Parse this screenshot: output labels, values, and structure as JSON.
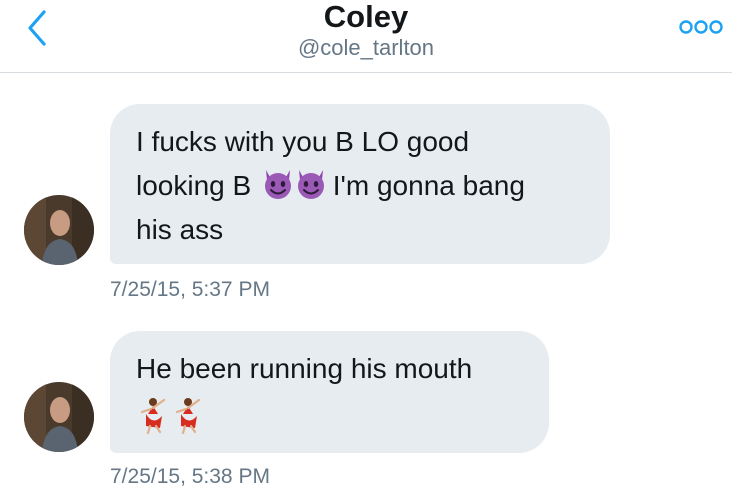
{
  "header": {
    "name": "Coley",
    "handle": "@cole_tarlton",
    "back_icon": "chevron-left-icon",
    "more_icon": "more-options-icon",
    "accent_color": "#1da1f2"
  },
  "messages": [
    {
      "text_part_1": "I fucks with you B LO good",
      "text_part_2": "looking B",
      "emoji_1": "smiling-devil-emoji",
      "text_part_3": "I'm gonna bang",
      "text_part_4": "his ass",
      "timestamp": "7/25/15, 5:37 PM"
    },
    {
      "text_part_1": "He been running his mouth",
      "emoji_1": "dancer-emoji",
      "timestamp": "7/25/15, 5:38 PM"
    }
  ],
  "colors": {
    "bubble_bg": "#e6ecf0",
    "text": "#14171a",
    "secondary_text": "#657786"
  }
}
